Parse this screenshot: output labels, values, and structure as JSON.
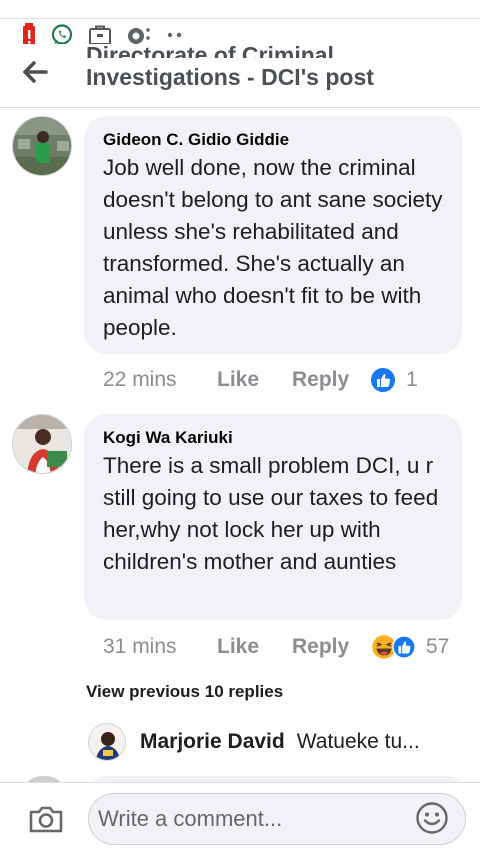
{
  "header": {
    "title_line1": "Directorate of Criminal",
    "title_line2": "Investigations - DCI's post"
  },
  "comments": [
    {
      "author": "Gideon C. Gidio Giddie",
      "text": "Job well done, now the criminal doesn't belong to ant sane society unless she's rehabilitated and transformed. She's actually an animal who doesn't fit to be with people.",
      "time": "22 mins",
      "like_label": "Like",
      "reply_label": "Reply",
      "reactions": [
        "like-reaction-icon"
      ],
      "reaction_count": "1"
    },
    {
      "author": "Kogi Wa Kariuki",
      "text": "There is a small problem DCI, u r still going to use our taxes to feed her,why not lock her up with children's mother and aunties",
      "time": "31 mins",
      "like_label": "Like",
      "reply_label": "Reply",
      "reactions": [
        "haha-reaction-icon",
        "like-reaction-icon"
      ],
      "reaction_count": "57"
    }
  ],
  "view_previous": "View previous 10 replies",
  "reply_preview": {
    "name": "Marjorie David",
    "text": "Watueke tu..."
  },
  "composer": {
    "placeholder": "Write a comment..."
  },
  "colors": {
    "like_blue": "#1877f2",
    "haha_yellow": "#f7b125",
    "bubble_bg": "#f0f2f5",
    "meta_gray": "#8a8d91"
  }
}
